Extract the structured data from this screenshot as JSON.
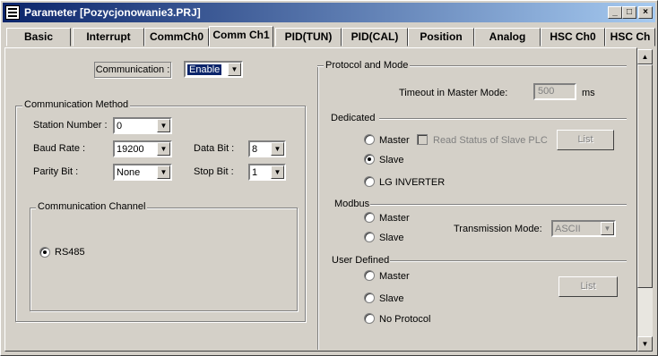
{
  "window": {
    "title": "Parameter [Pozycjonowanie3.PRJ]",
    "min_glyph": "_",
    "max_glyph": "□",
    "close_glyph": "×"
  },
  "tabs": [
    {
      "label": "Basic"
    },
    {
      "label": "Interrupt"
    },
    {
      "label": "CommCh0"
    },
    {
      "label": "Comm Ch1"
    },
    {
      "label": "PID(TUN)"
    },
    {
      "label": "PID(CAL)"
    },
    {
      "label": "Position"
    },
    {
      "label": "Analog"
    },
    {
      "label": "HSC Ch0"
    },
    {
      "label": "HSC Ch"
    }
  ],
  "active_tab": "Comm Ch1",
  "communication": {
    "label": "Communication :",
    "value": "Enable"
  },
  "method": {
    "title": "Communication Method",
    "station_label": "Station Number :",
    "station_value": "0",
    "baud_label": "Baud Rate :",
    "baud_value": "19200",
    "databit_label": "Data Bit :",
    "databit_value": "8",
    "parity_label": "Parity Bit :",
    "parity_value": "None",
    "stopbit_label": "Stop Bit :",
    "stopbit_value": "1",
    "channel": {
      "title": "Communication Channel",
      "rs485_label": "RS485",
      "rs485_checked": true
    }
  },
  "protocol": {
    "title": "Protocol and Mode",
    "timeout_label": "Timeout in Master Mode:",
    "timeout_value": "500",
    "timeout_unit": "ms",
    "dedicated": {
      "title": "Dedicated",
      "master_label": "Master",
      "read_status_label": "Read Status of Slave PLC",
      "list_label": "List",
      "slave_label": "Slave",
      "lg_label": "LG INVERTER",
      "selected": "Slave"
    },
    "modbus": {
      "title": "Modbus",
      "master_label": "Master",
      "slave_label": "Slave",
      "transmission_label": "Transmission Mode:",
      "transmission_value": "ASCII"
    },
    "user_defined": {
      "title": "User Defined",
      "master_label": "Master",
      "slave_label": "Slave",
      "no_protocol_label": "No Protocol",
      "list_label": "List"
    }
  },
  "icons": {
    "dropdown_arrow": "▼",
    "scroll_up": "▲",
    "scroll_down": "▼"
  }
}
